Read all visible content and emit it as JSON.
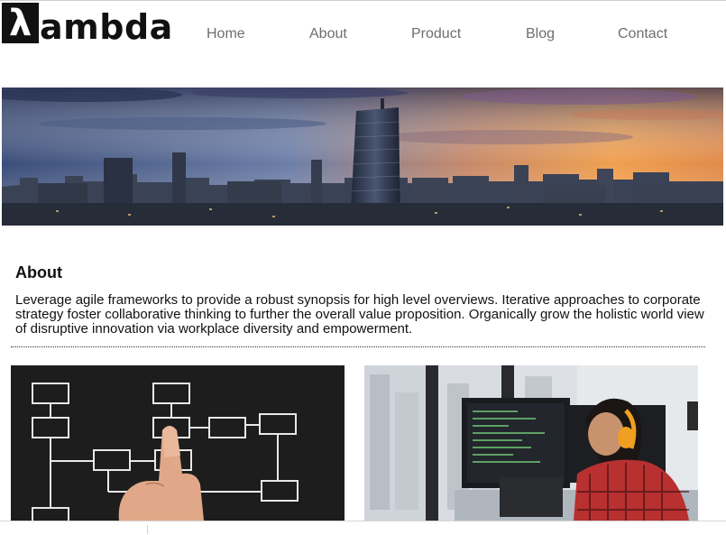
{
  "brand": {
    "logo_symbol": "λ",
    "logo_text": "ambda"
  },
  "nav": {
    "items": [
      {
        "label": "Home"
      },
      {
        "label": "About"
      },
      {
        "label": "Product"
      },
      {
        "label": "Blog"
      },
      {
        "label": "Contact"
      }
    ]
  },
  "about": {
    "title": "About",
    "body": "Leverage agile frameworks to provide a robust synopsis for high level overviews. Iterative approaches to corporate strategy foster collaborative thinking to further the overall value proposition. Organically grow the holistic world view of disruptive innovation via workplace diversity and empowerment."
  },
  "colors": {
    "logo_bg": "#111111",
    "nav_text": "#6e6e6e",
    "body_text": "#111111",
    "headphones": "#f0a020",
    "shirt": "#b83030"
  }
}
